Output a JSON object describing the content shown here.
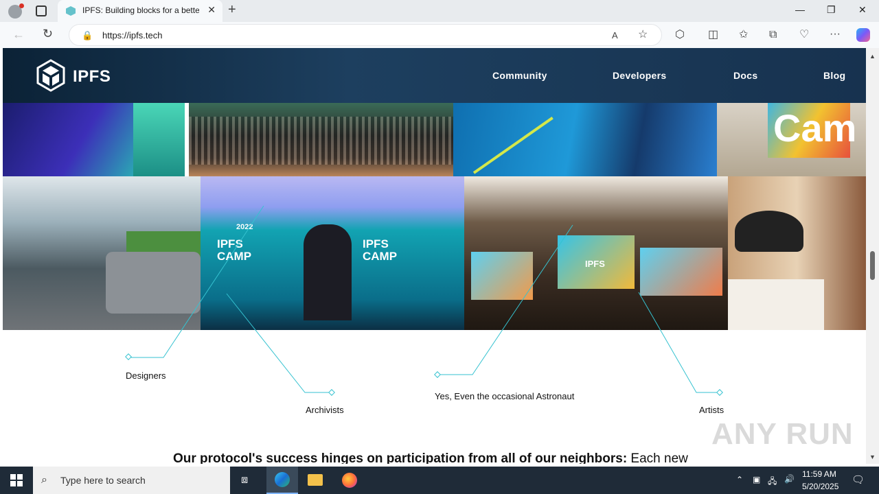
{
  "browser": {
    "tab_title": "IPFS: Building blocks for a better",
    "url": "https://ipfs.tech"
  },
  "site": {
    "logo_text": "IPFS",
    "nav": [
      "Community",
      "Developers",
      "Docs",
      "Blog"
    ]
  },
  "photos": {
    "camp_backdrop_text_1": "IPFS CAMP",
    "camp_backdrop_year": "2022",
    "stage_screen_text": "IPFS",
    "banner_letters": "Cam"
  },
  "labels": {
    "designers": "Designers",
    "archivists": "Archivists",
    "astronaut": "Yes, Even the occasional Astronaut",
    "artists": "Artists"
  },
  "content": {
    "bottom_bold": "Our protocol's success hinges on participation from all of our neighbors:",
    "bottom_rest": " Each new"
  },
  "watermark": "ANY RUN",
  "taskbar": {
    "search_placeholder": "Type here to search",
    "time": "11:59 AM",
    "date": "5/20/2025"
  },
  "colors": {
    "header_bg": "#17324f",
    "accent_line": "#35c2d0",
    "taskbar_bg": "#1f2b38"
  }
}
